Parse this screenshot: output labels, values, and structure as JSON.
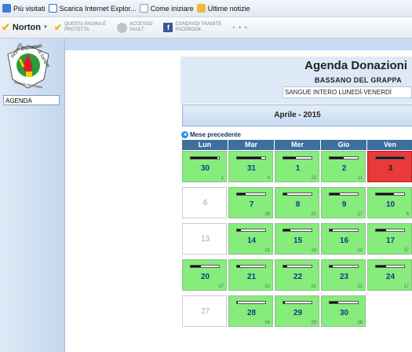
{
  "favorites": {
    "most_visited": "Più visitati",
    "download_ie": "Scarica Internet Explor...",
    "how_to_start": "Come iniziare",
    "latest_news": "Ultime notizie"
  },
  "norton_bar": {
    "brand": "Norton",
    "item1_line1": "QUESTA PAGINA È",
    "item1_line2": "PROTETTA",
    "item2_line1": "ACCESSO",
    "item2_line2": "VAULT",
    "item3_line1": "CONDIVIDI TRAMITE",
    "item3_line2": "FACEBOOK",
    "more": "• • •"
  },
  "sidebar": {
    "logo_text_top": "Donatori",
    "logo_text_side": "Reparto",
    "logo_text_right": "di Sangue",
    "logo_text_bottom": "Bassano del Grappa",
    "nav_label": "AGENDA"
  },
  "agenda": {
    "title": "Agenda Donazioni",
    "city": "BASSANO DEL GRAPPA",
    "donation_type": "SANGUE INTERO LUNEDÌ-VENERDÌ",
    "month": "Aprile - 2015",
    "prev_month": "Mese precedente",
    "weekdays": [
      "Lun",
      "Mar",
      "Mer",
      "Gio",
      "Ven"
    ],
    "weeks": [
      [
        {
          "day": "30",
          "count": "1",
          "status": "available",
          "fill": 0.95
        },
        {
          "day": "31",
          "count": "4",
          "status": "available",
          "fill": 0.85
        },
        {
          "day": "1",
          "count": "13",
          "status": "available",
          "fill": 0.45
        },
        {
          "day": "2",
          "count": "11",
          "status": "available",
          "fill": 0.5
        },
        {
          "day": "3",
          "count": "",
          "status": "full",
          "fill": 1.0
        }
      ],
      [
        {
          "day": "6",
          "count": "",
          "status": "closed",
          "fill": 0
        },
        {
          "day": "7",
          "count": "18",
          "status": "available",
          "fill": 0.3
        },
        {
          "day": "8",
          "count": "21",
          "status": "available",
          "fill": 0.15
        },
        {
          "day": "9",
          "count": "17",
          "status": "available",
          "fill": 0.35
        },
        {
          "day": "10",
          "count": "8",
          "status": "available",
          "fill": 0.65
        }
      ],
      [
        {
          "day": "13",
          "count": "",
          "status": "closed",
          "fill": 0
        },
        {
          "day": "14",
          "count": "21",
          "status": "available",
          "fill": 0.15
        },
        {
          "day": "15",
          "count": "19",
          "status": "available",
          "fill": 0.25
        },
        {
          "day": "16",
          "count": "22",
          "status": "available",
          "fill": 0.1
        },
        {
          "day": "17",
          "count": "17",
          "status": "available",
          "fill": 0.35
        }
      ],
      [
        {
          "day": "20",
          "count": "17",
          "status": "available",
          "fill": 0.35
        },
        {
          "day": "21",
          "count": "22",
          "status": "available",
          "fill": 0.1
        },
        {
          "day": "22",
          "count": "21",
          "status": "available",
          "fill": 0.15
        },
        {
          "day": "23",
          "count": "22",
          "status": "available",
          "fill": 0.1
        },
        {
          "day": "24",
          "count": "17",
          "status": "available",
          "fill": 0.35
        }
      ],
      [
        {
          "day": "27",
          "count": "",
          "status": "closed",
          "fill": 0
        },
        {
          "day": "28",
          "count": "24",
          "status": "available",
          "fill": 0.02
        },
        {
          "day": "29",
          "count": "23",
          "status": "available",
          "fill": 0.05
        },
        {
          "day": "30",
          "count": "18",
          "status": "available",
          "fill": 0.3
        },
        {
          "day": "",
          "count": "",
          "status": "none",
          "fill": 0
        }
      ]
    ]
  },
  "colors": {
    "available": "#86ec7c",
    "full": "#e8393b",
    "closed": "#ffffff",
    "header": "#3d6f9e"
  }
}
